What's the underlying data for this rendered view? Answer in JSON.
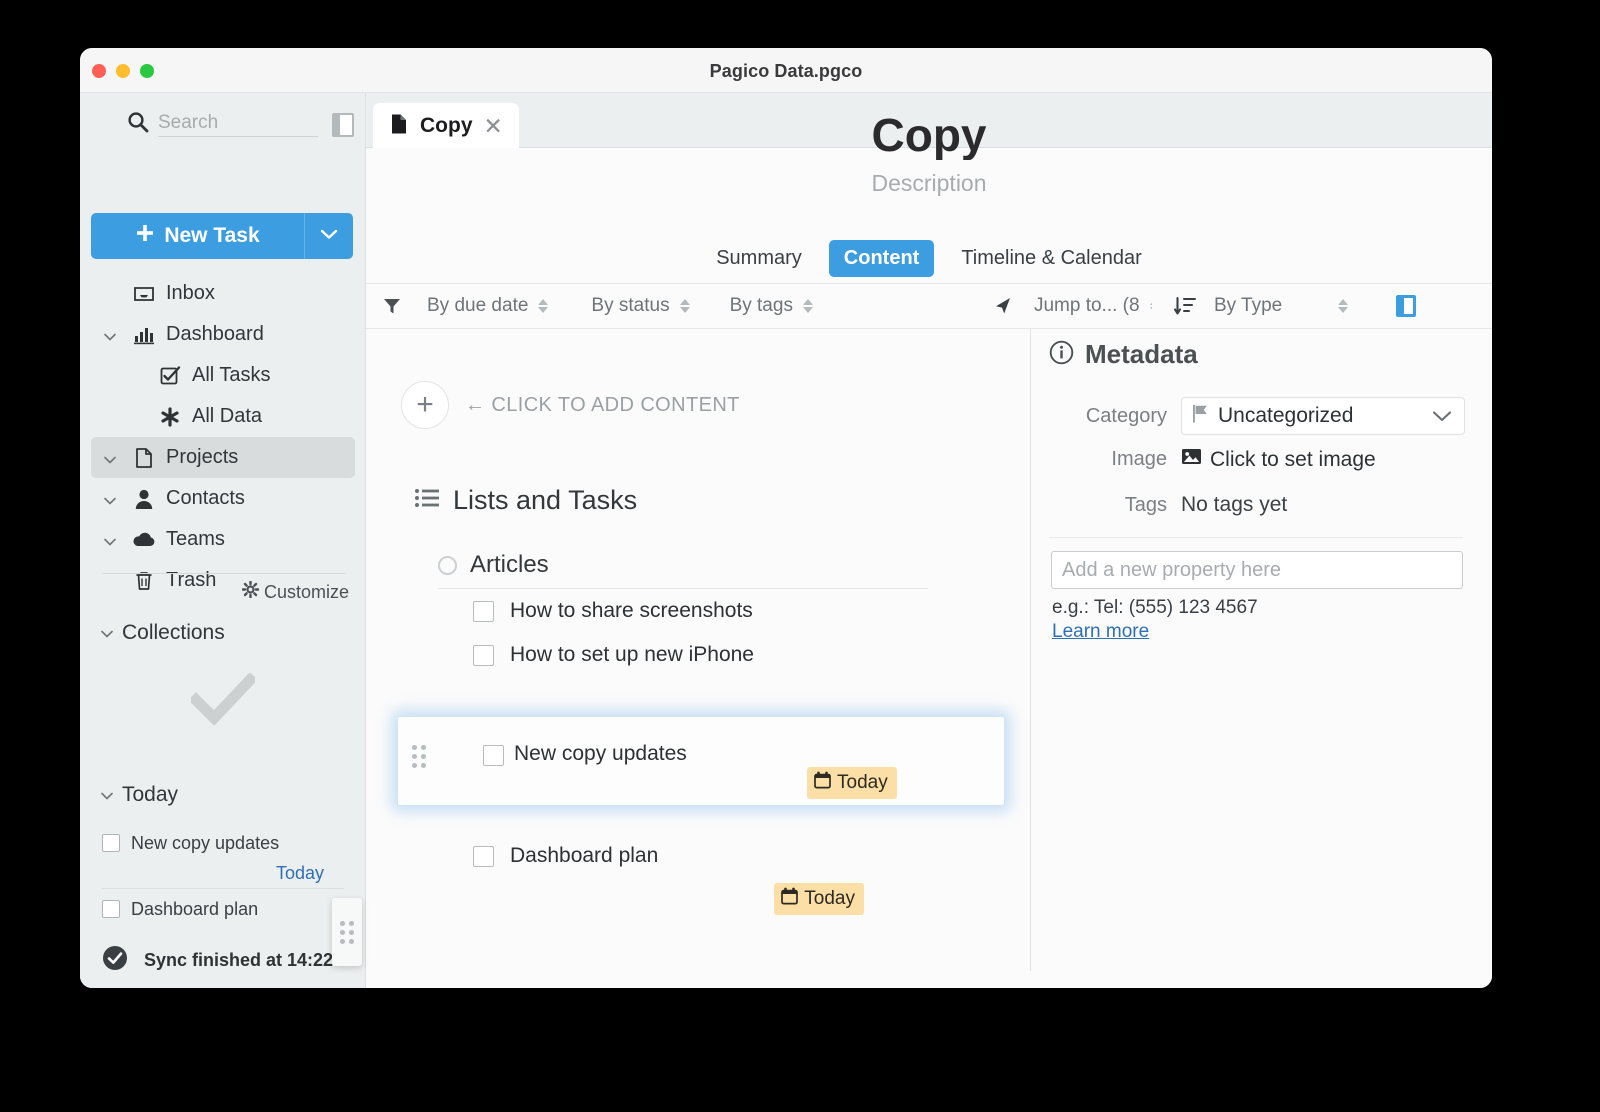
{
  "window": {
    "title": "Pagico Data.pgco",
    "traffic_lights": [
      "close",
      "minimize",
      "maximize"
    ]
  },
  "sidebar": {
    "search": {
      "value": "",
      "placeholder": "Search"
    },
    "new_task": {
      "label": "New Task",
      "plus": "+"
    },
    "nav": [
      {
        "label": "Inbox",
        "icon": "inbox-icon",
        "level": 0,
        "chevron": false,
        "selected": false
      },
      {
        "label": "Dashboard",
        "icon": "chart-bars-icon",
        "level": 0,
        "chevron": true,
        "selected": false
      },
      {
        "label": "All Tasks",
        "icon": "checkbox-checked-icon",
        "level": 1,
        "chevron": false,
        "selected": false
      },
      {
        "label": "All Data",
        "icon": "asterisk-icon",
        "level": 1,
        "chevron": false,
        "selected": false
      },
      {
        "label": "Projects",
        "icon": "document-icon",
        "level": 0,
        "chevron": true,
        "selected": true
      },
      {
        "label": "Contacts",
        "icon": "person-icon",
        "level": 0,
        "chevron": true,
        "selected": false
      },
      {
        "label": "Teams",
        "icon": "cloud-icon",
        "level": 0,
        "chevron": true,
        "selected": false
      },
      {
        "label": "Trash",
        "icon": "trash-icon",
        "level": 0,
        "chevron": false,
        "selected": false
      }
    ],
    "customize": {
      "label": "Customize",
      "icon": "gear-icon"
    },
    "collections": {
      "label": "Collections",
      "empty_icon": "checkmark-icon"
    },
    "today": {
      "label": "Today",
      "tasks": [
        {
          "label": "New copy updates",
          "due": "Today"
        },
        {
          "label": "Dashboard plan",
          "due": ""
        }
      ]
    },
    "sync": {
      "label": "Sync finished at 14:22",
      "icon": "check-circle-icon"
    }
  },
  "main": {
    "tab": {
      "label": "Copy",
      "icon": "document-icon",
      "close": "✕"
    },
    "document": {
      "title": "Copy",
      "description": "Description"
    },
    "view_tabs": [
      {
        "label": "Summary",
        "active": false
      },
      {
        "label": "Content",
        "active": true
      },
      {
        "label": "Timeline & Calendar",
        "active": false
      }
    ],
    "toolbar": {
      "filter_icon": "funnel-icon",
      "filters": [
        {
          "label": "By due date"
        },
        {
          "label": "By status"
        },
        {
          "label": "By tags"
        }
      ],
      "jump_icon": "navigation-arrow-icon",
      "jump": {
        "label": "Jump to... (8"
      },
      "sort_icon": "sort-descending-icon",
      "sort": {
        "label": "By Type"
      },
      "panel_toggle_icon": "right-panel-icon"
    },
    "add_content": {
      "label": "CLICK TO ADD CONTENT",
      "arrow": "←",
      "plus": "+"
    },
    "lists_and_tasks": {
      "heading": "Lists and Tasks",
      "heading_icon": "list-icon",
      "lists": [
        {
          "name": "Articles",
          "items": [
            {
              "label": "How to share screenshots",
              "checked": false
            },
            {
              "label": "How to set up new iPhone",
              "checked": false
            }
          ]
        }
      ],
      "dragged_card": {
        "label": "New copy updates",
        "checked": false,
        "badge": "Today",
        "badge_icon": "calendar-icon",
        "handle_icon": "drag-handle-icon"
      },
      "tasks": [
        {
          "label": "Dashboard plan",
          "checked": false,
          "badge": "Today",
          "badge_icon": "calendar-icon"
        }
      ]
    }
  },
  "metadata": {
    "heading": "Metadata",
    "heading_icon": "info-circle-icon",
    "category": {
      "key": "Category",
      "value": "Uncategorized",
      "icon": "flag-icon"
    },
    "image": {
      "key": "Image",
      "value": "Click to set image",
      "icon": "image-icon"
    },
    "tags": {
      "key": "Tags",
      "value": "No tags yet"
    },
    "new_property": {
      "placeholder": "Add a new property here",
      "value": ""
    },
    "hint": "e.g.: Tel: (555) 123 4567",
    "learn_more": "Learn more"
  },
  "colors": {
    "accent_blue": "#3c9ee0",
    "link_blue": "#2f6fb5",
    "badge_amber": "#fcdfa6",
    "sidebar_bg": "#eceff0",
    "selected_nav": "#d9dcdd"
  }
}
